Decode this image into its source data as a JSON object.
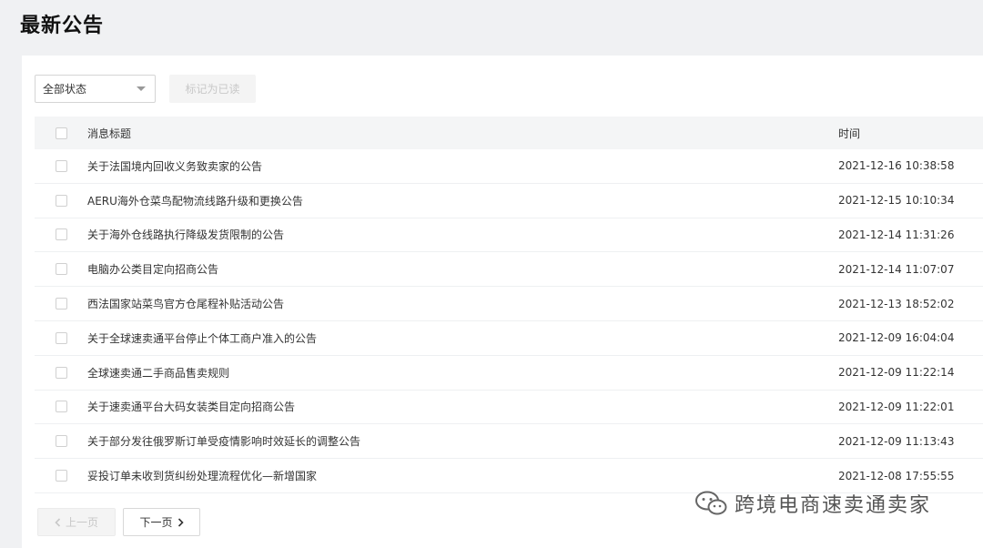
{
  "page": {
    "title": "最新公告"
  },
  "toolbar": {
    "status_filter": "全部状态",
    "mark_read_label": "标记为已读"
  },
  "table": {
    "col_title": "消息标题",
    "col_time": "时间",
    "rows": [
      {
        "title": "关于法国境内回收义务致卖家的公告",
        "time": "2021-12-16 10:38:58"
      },
      {
        "title": "AERU海外仓菜鸟配物流线路升级和更换公告",
        "time": "2021-12-15 10:10:34"
      },
      {
        "title": "关于海外仓线路执行降级发货限制的公告",
        "time": "2021-12-14 11:31:26"
      },
      {
        "title": "电脑办公类目定向招商公告",
        "time": "2021-12-14 11:07:07"
      },
      {
        "title": "西法国家站菜鸟官方仓尾程补贴活动公告",
        "time": "2021-12-13 18:52:02"
      },
      {
        "title": "关于全球速卖通平台停止个体工商户准入的公告",
        "time": "2021-12-09 16:04:04"
      },
      {
        "title": "全球速卖通二手商品售卖规则",
        "time": "2021-12-09 11:22:14"
      },
      {
        "title": "关于速卖通平台大码女装类目定向招商公告",
        "time": "2021-12-09 11:22:01"
      },
      {
        "title": "关于部分发往俄罗斯订单受疫情影响时效延长的调整公告",
        "time": "2021-12-09 11:13:43"
      },
      {
        "title": "妥投订单未收到货纠纷处理流程优化—新增国家",
        "time": "2021-12-08 17:55:55"
      }
    ]
  },
  "pagination": {
    "prev_label": "上一页",
    "next_label": "下一页"
  },
  "watermark": {
    "text": "跨境电商速卖通卖家",
    "icon": "wechat-icon"
  }
}
